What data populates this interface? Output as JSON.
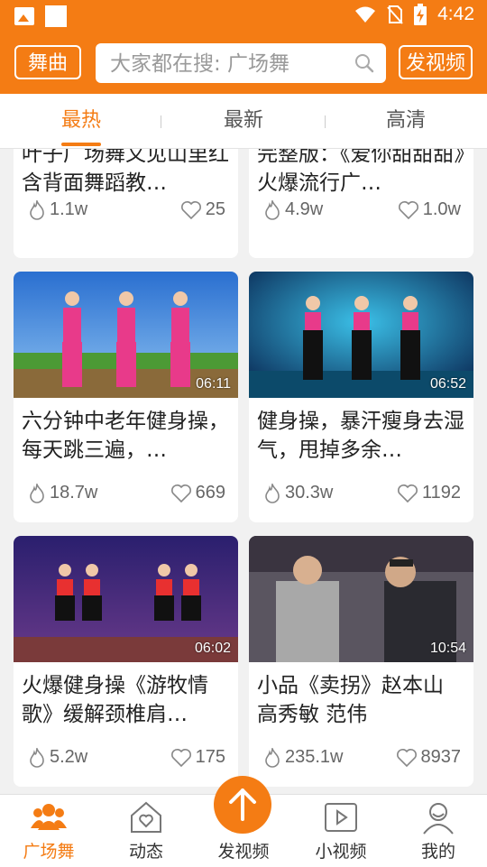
{
  "status_bar": {
    "time": "4:42"
  },
  "header": {
    "left_button": "舞曲",
    "search_placeholder": "大家都在搜: 广场舞",
    "right_button": "发视频"
  },
  "tabs": [
    {
      "label": "最热",
      "active": true
    },
    {
      "label": "最新",
      "active": false
    },
    {
      "label": "高清",
      "active": false
    }
  ],
  "cards": [
    {
      "title": "叶子广场舞又见山里红 含背面舞蹈教…",
      "views": "1.1w",
      "likes": "25"
    },
    {
      "title": "完整版：《爱你甜甜甜》火爆流行广…",
      "views": "4.9w",
      "likes": "1.0w"
    },
    {
      "title": "六分钟中老年健身操，每天跳三遍，…",
      "duration": "06:11",
      "views": "18.7w",
      "likes": "669"
    },
    {
      "title": "健身操，暴汗瘦身去湿气，甩掉多余…",
      "duration": "06:52",
      "views": "30.3w",
      "likes": "1192"
    },
    {
      "title": "火爆健身操《游牧情歌》缓解颈椎肩…",
      "duration": "06:02",
      "views": "5.2w",
      "likes": "175"
    },
    {
      "title": "小品《卖拐》赵本山 高秀敏 范伟",
      "duration": "10:54",
      "views": "235.1w",
      "likes": "8937"
    }
  ],
  "bottom_nav": [
    {
      "label": "广场舞",
      "icon": "people-icon",
      "active": true
    },
    {
      "label": "动态",
      "icon": "home-heart-icon",
      "active": false
    },
    {
      "label": "发视频",
      "icon": "upload-arrow-icon",
      "active": false
    },
    {
      "label": "小视频",
      "icon": "play-box-icon",
      "active": false
    },
    {
      "label": "我的",
      "icon": "user-icon",
      "active": false
    }
  ],
  "colors": {
    "accent": "#f47c14"
  }
}
